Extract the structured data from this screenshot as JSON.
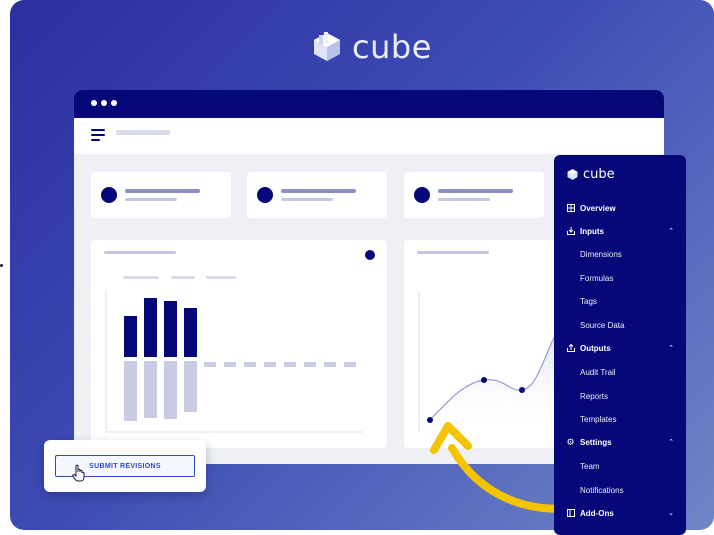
{
  "brand": {
    "name": "cube"
  },
  "sidebar": {
    "brand": "cube",
    "items": [
      {
        "label": "Overview",
        "icon": "grid-icon",
        "type": "header"
      },
      {
        "label": "Inputs",
        "icon": "inbox-icon",
        "type": "header",
        "chevron": "up"
      },
      {
        "label": "Dimensions",
        "type": "sub"
      },
      {
        "label": "Formulas",
        "type": "sub"
      },
      {
        "label": "Tags",
        "type": "sub"
      },
      {
        "label": "Source Data",
        "type": "sub"
      },
      {
        "label": "Outputs",
        "icon": "upload-icon",
        "type": "header",
        "chevron": "up"
      },
      {
        "label": "Audit Trail",
        "type": "sub"
      },
      {
        "label": "Reports",
        "type": "sub"
      },
      {
        "label": "Templates",
        "type": "sub"
      },
      {
        "label": "Settings",
        "icon": "gear-icon",
        "type": "header",
        "chevron": "up"
      },
      {
        "label": "Team",
        "type": "sub"
      },
      {
        "label": "Notifications",
        "type": "sub"
      },
      {
        "label": "Add-Ons",
        "icon": "addons-icon",
        "type": "header",
        "chevron": "down"
      }
    ]
  },
  "submit": {
    "label": "SUBMIT REVISIONS"
  },
  "colors": {
    "navy": "#06087a",
    "accent_blue": "#2f49c4",
    "arrow_yellow": "#f5c400",
    "bar_muted": "#c9cbe2"
  }
}
